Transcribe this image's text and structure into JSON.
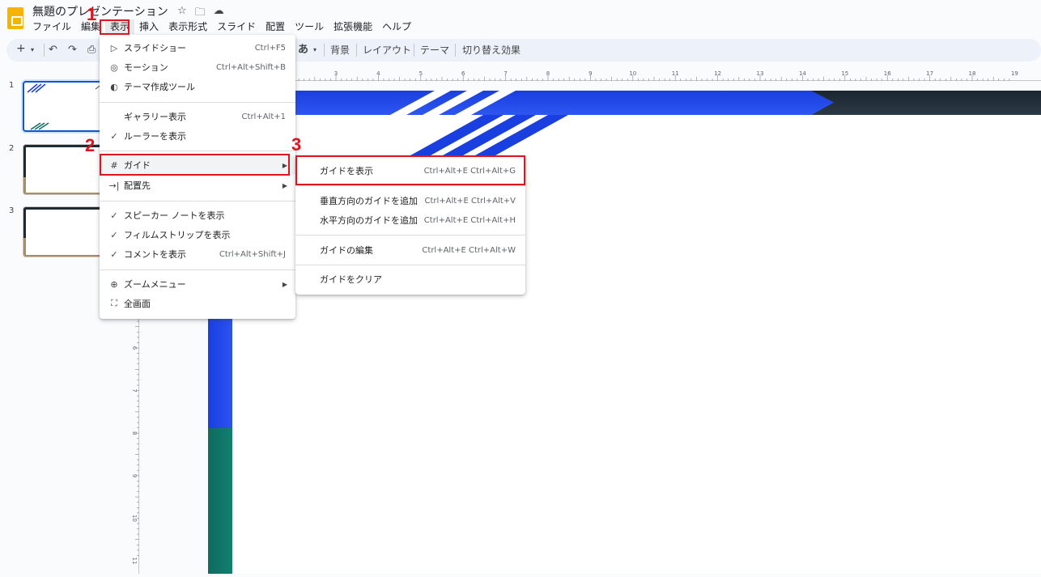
{
  "app": {
    "title": "無題のプレゼンテーション",
    "icons": [
      "star-icon",
      "move-to-folder-icon",
      "cloud-saved-icon"
    ]
  },
  "menubar": [
    "ファイル",
    "編集",
    "表示",
    "挿入",
    "表示形式",
    "スライド",
    "配置",
    "ツール",
    "拡張機能",
    "ヘルプ"
  ],
  "toolbar": {
    "new": "+",
    "undo": "↶",
    "redo": "↷",
    "print": "⎙",
    "input": "あ",
    "background": "背景",
    "layout": "レイアウト",
    "theme": "テーマ",
    "transition": "切り替え効果"
  },
  "slides": [
    "1",
    "2",
    "3"
  ],
  "ruler": {
    "h_ticks": [
      "3",
      "4",
      "5",
      "6",
      "7",
      "8",
      "9",
      "10",
      "11",
      "12",
      "13",
      "14",
      "15",
      "16",
      "17",
      "18",
      "19"
    ],
    "v_ticks": [
      "6",
      "7",
      "8",
      "9",
      "10",
      "11"
    ]
  },
  "view_menu": {
    "items": [
      {
        "icon": "slideshow-icon",
        "label": "スライドショー",
        "shortcut": "Ctrl+F5"
      },
      {
        "icon": "motion-icon",
        "label": "モーション",
        "shortcut": "Ctrl+Alt+Shift+B"
      },
      {
        "icon": "palette-icon",
        "label": "テーマ作成ツール",
        "shortcut": ""
      },
      {
        "icon": "",
        "label": "ギャラリー表示",
        "shortcut": "Ctrl+Alt+1"
      },
      {
        "icon": "check-icon",
        "label": "ルーラーを表示",
        "shortcut": ""
      },
      {
        "icon": "grid-icon",
        "label": "ガイド",
        "shortcut": ""
      },
      {
        "icon": "snap-to-icon",
        "label": "配置先",
        "shortcut": ""
      },
      {
        "icon": "check-icon",
        "label": "スピーカー ノートを表示",
        "shortcut": ""
      },
      {
        "icon": "check-icon",
        "label": "フィルムストリップを表示",
        "shortcut": ""
      },
      {
        "icon": "check-icon",
        "label": "コメントを表示",
        "shortcut": "Ctrl+Alt+Shift+J"
      },
      {
        "icon": "zoom-icon",
        "label": "ズームメニュー",
        "shortcut": ""
      },
      {
        "icon": "fullscreen-icon",
        "label": "全画面",
        "shortcut": ""
      }
    ]
  },
  "guides_submenu": {
    "items": [
      {
        "label": "ガイドを表示",
        "shortcut": "Ctrl+Alt+E Ctrl+Alt+G"
      },
      {
        "label": "垂直方向のガイドを追加",
        "shortcut": "Ctrl+Alt+E Ctrl+Alt+V"
      },
      {
        "label": "水平方向のガイドを追加",
        "shortcut": "Ctrl+Alt+E Ctrl+Alt+H"
      },
      {
        "label": "ガイドの編集",
        "shortcut": "Ctrl+Alt+E Ctrl+Alt+W"
      },
      {
        "label": "ガイドをクリア",
        "shortcut": ""
      }
    ]
  },
  "annotations": {
    "step1": "1",
    "step2": "2",
    "step3": "3"
  },
  "colors": {
    "accent_red": "#e0141e",
    "slide_blue": "#1a3fe0",
    "slide_teal": "#0e6b5f",
    "slide_dark": "#1f2a33",
    "slide_gold": "#b08d57"
  }
}
